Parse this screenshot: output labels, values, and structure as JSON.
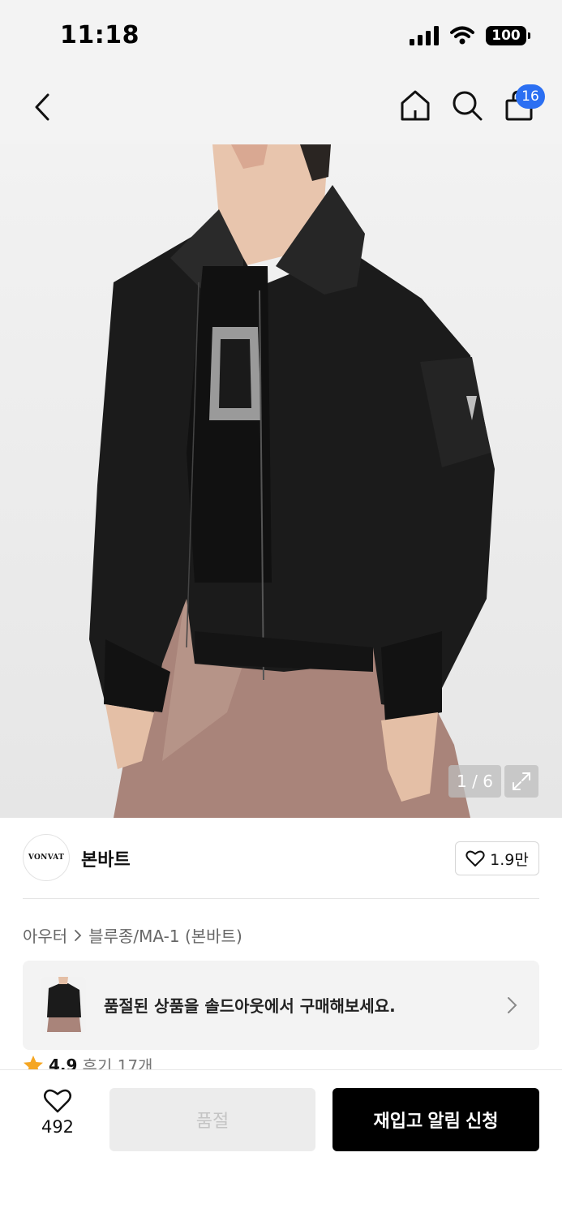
{
  "status_bar": {
    "time": "11:18",
    "battery": "100"
  },
  "nav": {
    "cart_count": "16"
  },
  "gallery": {
    "counter": "1 / 6"
  },
  "brand": {
    "logo_text": "VONVAT",
    "name": "본바트",
    "like_count": "1.9만"
  },
  "breadcrumb": {
    "category": "아우터",
    "subcategory": "블루종/MA-1 (본바트)"
  },
  "soldout_banner": {
    "text": "품절된 상품을 솔드아웃에서 구매해보세요."
  },
  "rating": {
    "score": "4.9",
    "reviews": "후기 17개"
  },
  "bottom_bar": {
    "wish_count": "492",
    "soldout_label": "품절",
    "restock_label": "재입고 알림 신청"
  }
}
